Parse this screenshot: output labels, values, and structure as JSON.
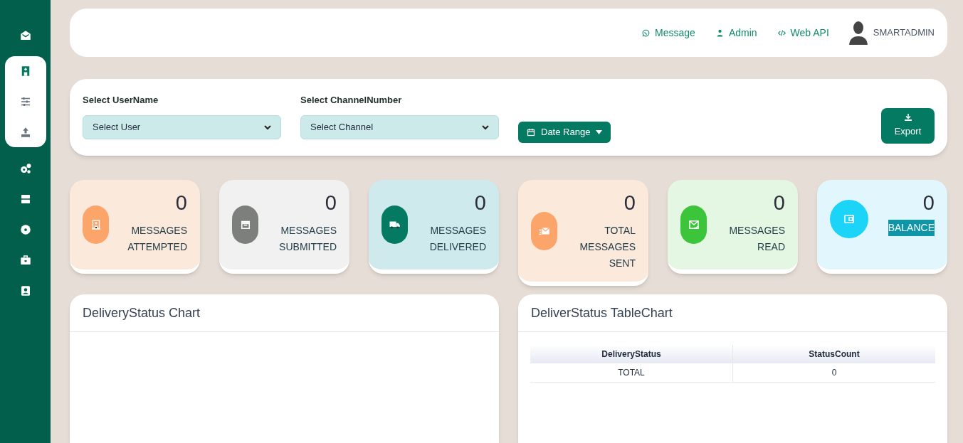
{
  "sidebar": {
    "items": [
      {
        "selected": false
      },
      {
        "expanded": true,
        "children": [
          {
            "selected": true
          },
          {
            "selected": false
          },
          {
            "selected": false
          }
        ]
      },
      {
        "selected": false
      },
      {
        "selected": false
      },
      {
        "selected": false
      },
      {
        "selected": false
      },
      {
        "selected": false
      }
    ]
  },
  "header": {
    "links": [
      "Message",
      "Admin",
      "Web API"
    ],
    "user": "SMARTADMIN"
  },
  "filters": {
    "user_label": "Select UserName",
    "user_select": "Select User",
    "channel_label": "Select ChannelNumber",
    "channel_select": "Select Channel",
    "date_range": "Date Range",
    "export": "Export"
  },
  "stats": [
    {
      "value": "0",
      "label": "MESSAGES ATTEMPTED",
      "color": "#fbe9dc",
      "highlighted": false
    },
    {
      "value": "0",
      "label": "MESSAGES SUBMITTED",
      "color": "#f1f1f1",
      "highlighted": false
    },
    {
      "value": "0",
      "label": "MESSAGES DELIVERED",
      "color": "#cfeaec",
      "highlighted": false
    },
    {
      "value": "0",
      "label": "TOTAL MESSAGES SENT",
      "color": "#fbe9dc",
      "highlighted": false
    },
    {
      "value": "0",
      "label": "MESSAGES READ",
      "color": "#e4f7e2",
      "highlighted": false
    },
    {
      "value": "0",
      "label": "BALANCE",
      "color": "#e2f7fd",
      "highlighted": true
    }
  ],
  "chart_panel": {
    "title": "DeliveryStatus Chart"
  },
  "table_panel": {
    "title": "DeliverStatus TableChart",
    "columns": [
      "DeliveryStatus",
      "StatusCount"
    ],
    "rows": [
      [
        "TOTAL",
        "0"
      ]
    ]
  }
}
